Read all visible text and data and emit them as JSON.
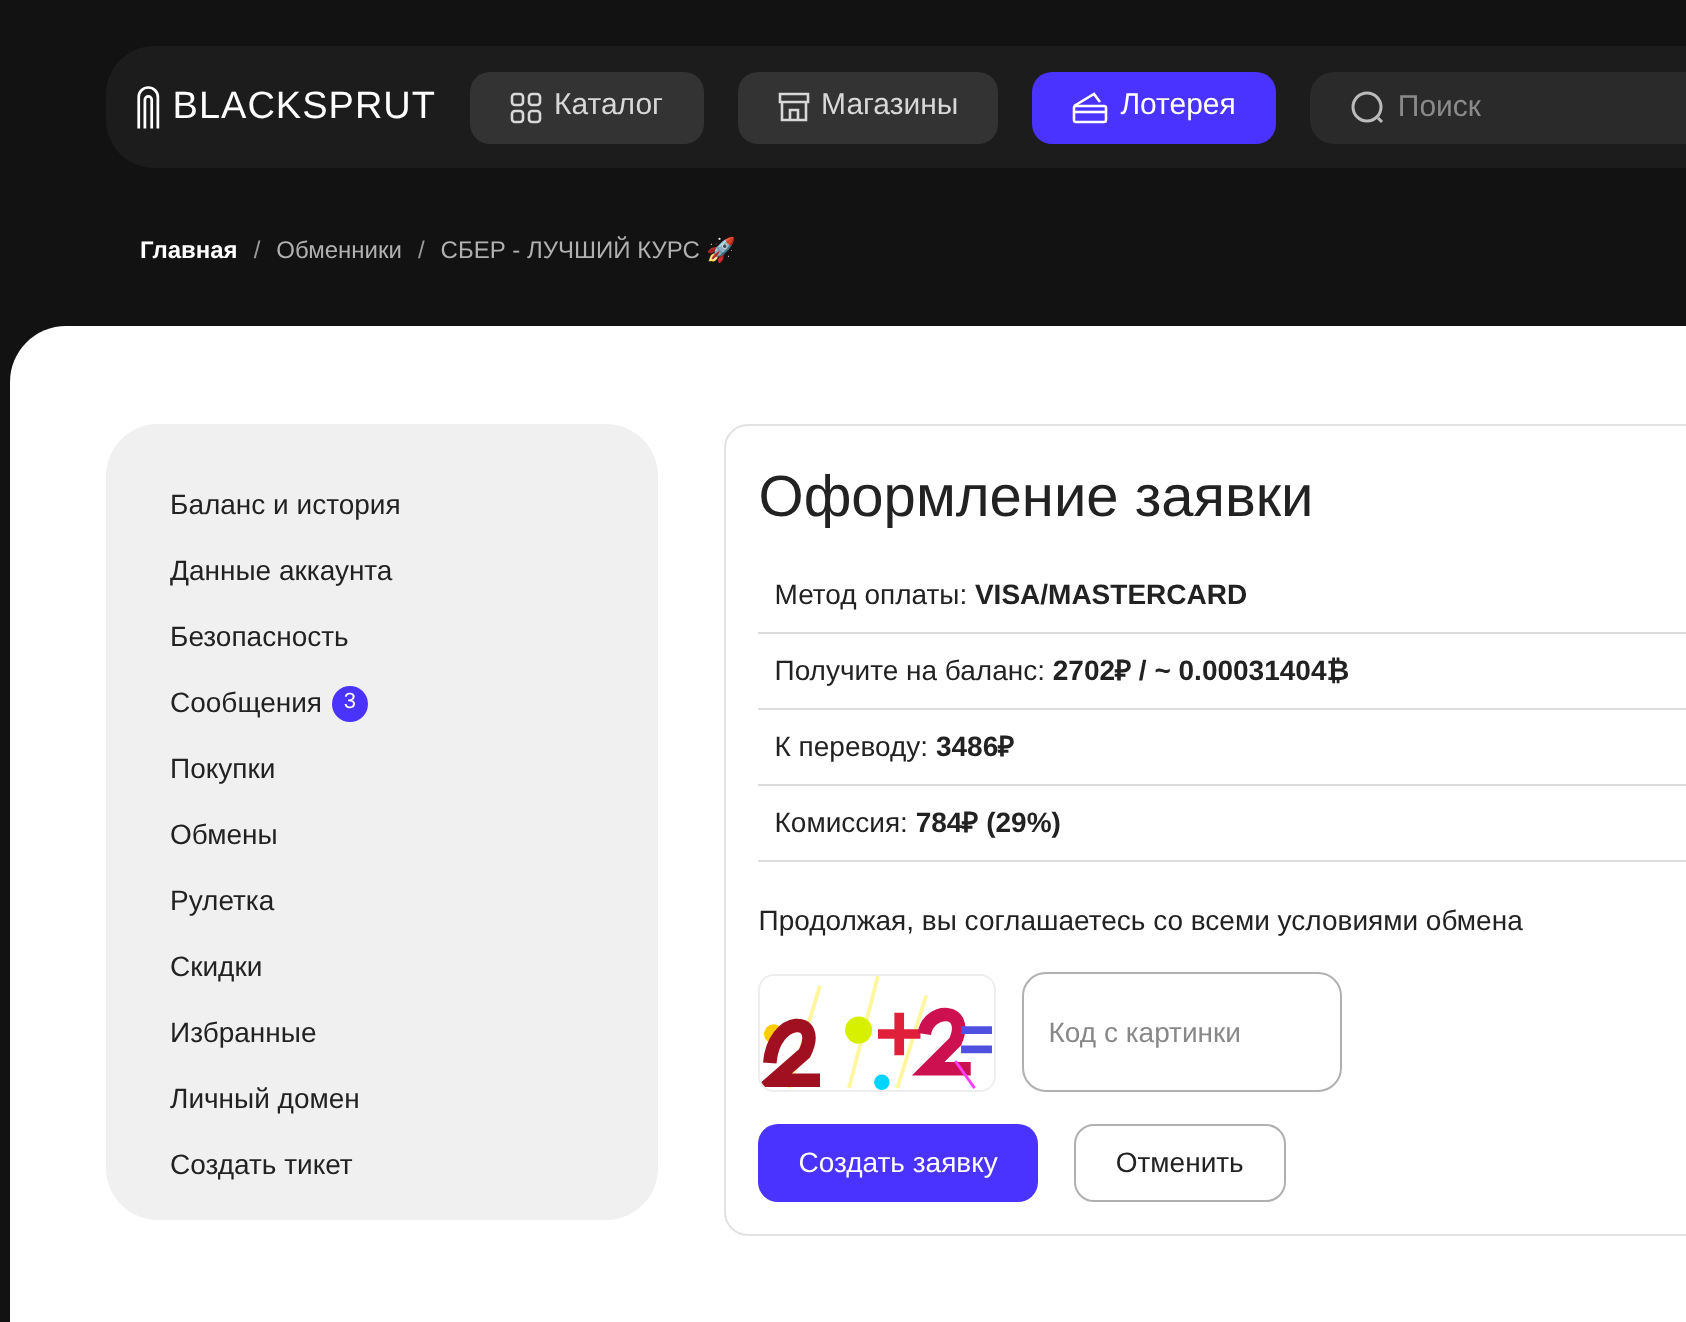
{
  "header": {
    "logo": "BLACKSPRUT",
    "nav": [
      {
        "label": "Каталог",
        "kind": "grid",
        "selected": false
      },
      {
        "label": "Магазины",
        "kind": "store",
        "selected": false
      },
      {
        "label": "Лотерея",
        "kind": "ticket",
        "selected": true
      }
    ],
    "search": {
      "placeholder": "Поиск"
    }
  },
  "breadcrumbs": {
    "separator": "/",
    "items": [
      "Главная",
      "Обменники",
      "СБЕР - ЛУЧШИЙ КУРС 🚀"
    ]
  },
  "sidebar": {
    "items": [
      {
        "label": "Баланс и история"
      },
      {
        "label": "Данные аккаунта"
      },
      {
        "label": "Безопасность"
      },
      {
        "label": "Сообщения",
        "badge": "3"
      },
      {
        "label": "Покупки"
      },
      {
        "label": "Обмены"
      },
      {
        "label": "Рулетка"
      },
      {
        "label": "Скидки"
      },
      {
        "label": "Избранные"
      },
      {
        "label": "Личный домен"
      },
      {
        "label": "Создать тикет"
      }
    ]
  },
  "order": {
    "title": "Оформление заявки",
    "rows": [
      {
        "label": "Метод оплаты:",
        "value": "VISA/MASTERCARD"
      },
      {
        "label": "Получите на баланс:",
        "value": "2702₽ / ~ 0.00031404₿"
      },
      {
        "label": "К переводу:",
        "value": "3486₽"
      },
      {
        "label": "Комиссия:",
        "value": "784₽ (29%)"
      }
    ],
    "note": "Продолжая, вы соглашаетесь со всеми условиями обмена",
    "captcha_field": {
      "placeholder": "Код с картинки"
    },
    "buttons": [
      {
        "label": "Создать заявку",
        "kind": "primary"
      },
      {
        "label": "Отменить",
        "kind": "secondary"
      }
    ]
  }
}
